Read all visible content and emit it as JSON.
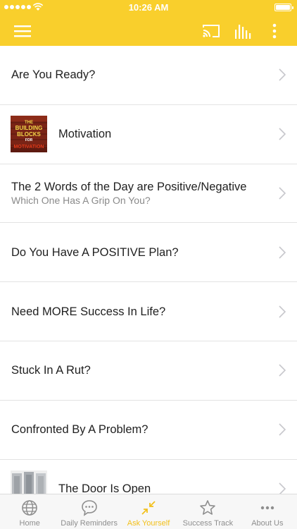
{
  "status": {
    "time": "10:26 AM"
  },
  "navbar": {
    "icons": [
      "menu-icon",
      "cast-icon",
      "equalizer-icon",
      "more-vertical-icon"
    ],
    "accent": "#f9cf2c"
  },
  "list": {
    "items": [
      {
        "title": "Are You Ready?"
      },
      {
        "title": "Motivation",
        "thumb": "the-building-blocks-for-motivation-thumbnail",
        "thumb_text": [
          "THE",
          "BUILDING",
          "BLOCKS",
          "FOR",
          "MOTIVATION"
        ]
      },
      {
        "title": "The 2 Words of the Day are Positive/Negative",
        "subtitle": "Which One Has A Grip On You?"
      },
      {
        "title": "Do You Have A POSITIVE Plan?"
      },
      {
        "title": "Need MORE Success In Life?"
      },
      {
        "title": "Stuck In A Rut?"
      },
      {
        "title": "Confronted By A Problem?"
      },
      {
        "title": "The Door Is Open",
        "thumb": "doors-thumbnail"
      }
    ]
  },
  "tabbar": {
    "active_color": "#f2c01c",
    "tabs": [
      {
        "label": "Home",
        "icon": "globe-icon"
      },
      {
        "label": "Daily Reminders",
        "icon": "chat-bubble-icon"
      },
      {
        "label": "Ask Yourself",
        "icon": "collapse-arrows-icon",
        "active": true
      },
      {
        "label": "Success Track",
        "icon": "star-icon"
      },
      {
        "label": "About Us",
        "icon": "ellipsis-icon"
      }
    ]
  }
}
